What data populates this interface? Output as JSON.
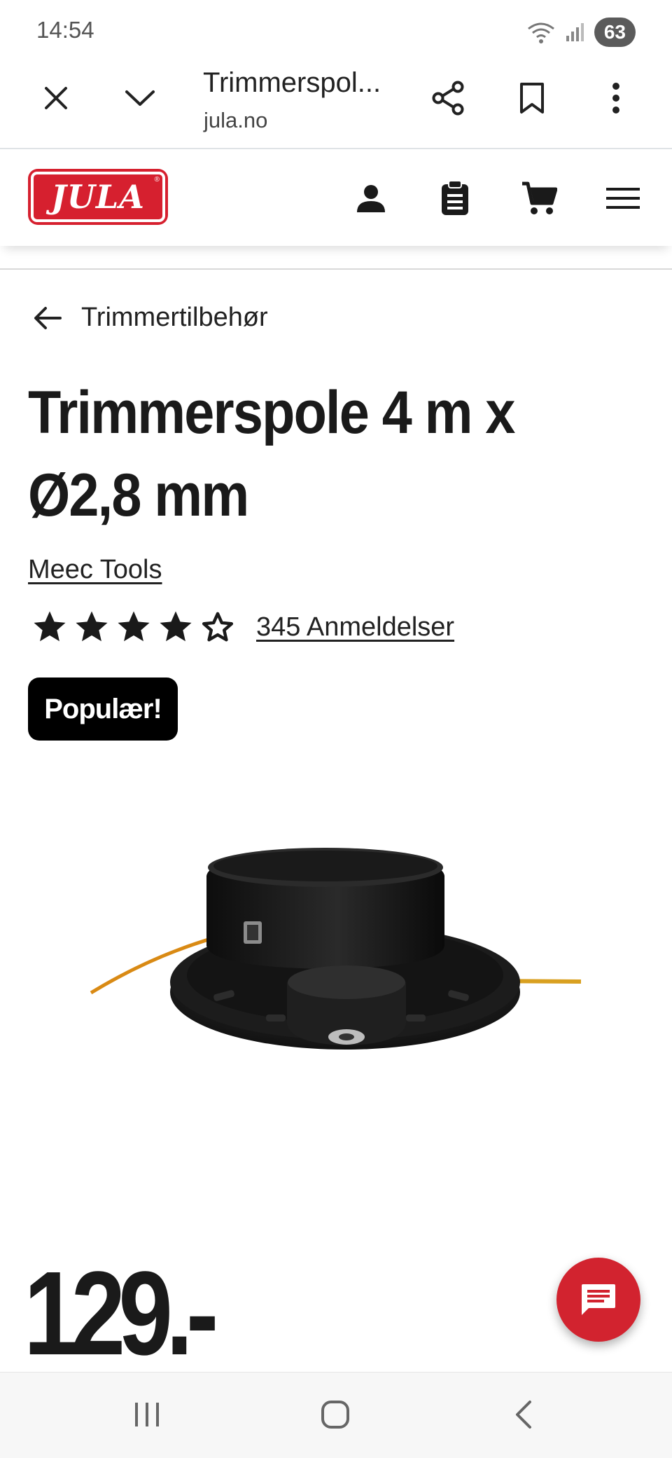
{
  "status_bar": {
    "time": "14:54",
    "battery": "63"
  },
  "browser": {
    "tab_title": "Trimmerspol...",
    "domain": "jula.no"
  },
  "site": {
    "logo_text": "JULA"
  },
  "breadcrumb": {
    "label": "Trimmertilbehør"
  },
  "product": {
    "title": "Trimmerspole 4 m x Ø2,8 mm",
    "brand": "Meec Tools",
    "rating_stars": 4,
    "rating_max": 5,
    "reviews": "345 Anmeldelser",
    "badge": "Populær!",
    "price": "129.-"
  },
  "colors": {
    "brand_red": "#d6202f",
    "text": "#1a1a1a",
    "badge_bg": "#000000"
  }
}
